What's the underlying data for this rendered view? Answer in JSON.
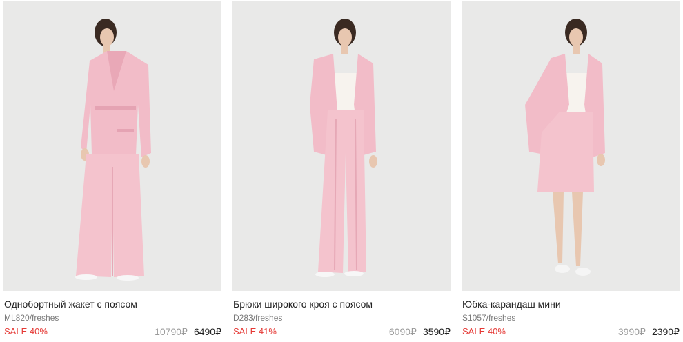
{
  "products": [
    {
      "title": "Однобортный жакет с поясом",
      "sku": "ML820/freshes",
      "sale": "SALE 40%",
      "old_price": "10790₽",
      "new_price": "6490₽",
      "image_icon": "product-photo-jacket"
    },
    {
      "title": "Брюки широкого кроя с поясом",
      "sku": "D283/freshes",
      "sale": "SALE 41%",
      "old_price": "6090₽",
      "new_price": "3590₽",
      "image_icon": "product-photo-trousers"
    },
    {
      "title": "Юбка-карандаш мини",
      "sku": "S1057/freshes",
      "sale": "SALE 40%",
      "old_price": "3990₽",
      "new_price": "2390₽",
      "image_icon": "product-photo-skirt"
    }
  ],
  "colors": {
    "sale": "#e53935",
    "photo_bg": "#e9e9e8",
    "garment_pink": "#f2bcc8"
  }
}
